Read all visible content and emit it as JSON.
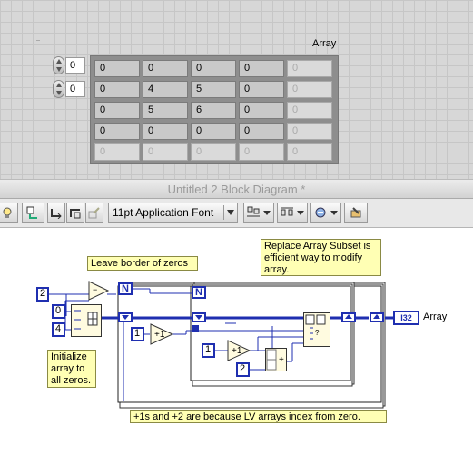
{
  "front_panel": {
    "array_label": "Array",
    "index_controls": [
      "0",
      "0"
    ],
    "array_cells": [
      [
        "0",
        "0",
        "0",
        "0",
        "0"
      ],
      [
        "0",
        "4",
        "5",
        "0",
        "0"
      ],
      [
        "0",
        "5",
        "6",
        "0",
        "0"
      ],
      [
        "0",
        "0",
        "0",
        "0",
        "0"
      ],
      [
        "0",
        "0",
        "0",
        "0",
        "0"
      ]
    ]
  },
  "block_diagram": {
    "window_title": "Untitled 2 Block Diagram *",
    "toolbar": {
      "font_selector": "11pt Application Font",
      "icons": [
        "highlight-execution-icon",
        "retain-wire-values-icon",
        "step-into-icon",
        "step-over-icon",
        "step-out-icon",
        "align-objects-icon",
        "distribute-objects-icon",
        "reorder-icon",
        "cleanup-diagram-icon"
      ]
    },
    "comments": {
      "border": "Leave border of zeros",
      "replace": "Replace Array Subset is efficient way to modify array.",
      "init": "Initialize array to all zeros.",
      "index": "+1s and +2 are because LV arrays index from zero."
    },
    "constants": {
      "n_const": "2",
      "zero_const": "0",
      "four_const": "4",
      "one_const": "1",
      "one_const_inner": "1",
      "two_const": "2"
    },
    "terminals": {
      "n_outer": "N",
      "n_inner": "N",
      "array_indicator": "I32",
      "array_label": "Array"
    },
    "functions": {
      "subtract": "−",
      "increment_outer": "+1",
      "increment_inner": "+1",
      "add": "+"
    },
    "colors": {
      "wire_blue": "#1f2fb0",
      "comment_yellow": "#ffffb4"
    }
  }
}
